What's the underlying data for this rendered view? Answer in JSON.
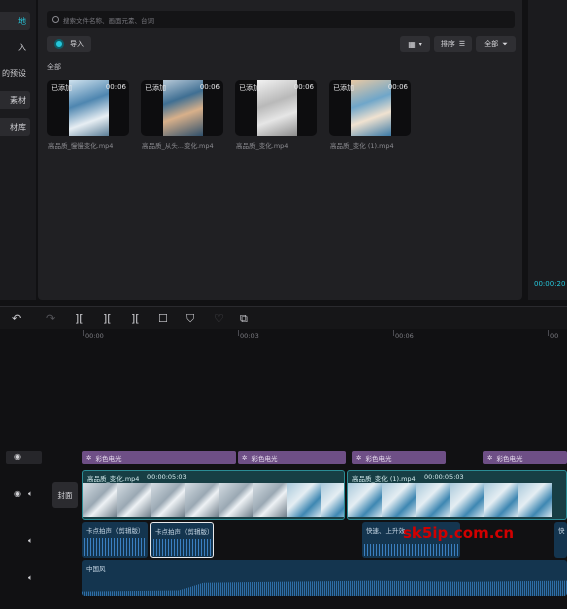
{
  "sidebar": {
    "items": [
      {
        "label": "地",
        "active": true
      },
      {
        "label": "入"
      },
      {
        "label": "的预设"
      },
      {
        "label": "素材"
      },
      {
        "label": "材库"
      }
    ]
  },
  "media": {
    "search_placeholder": "搜索文件名称、画面元素、台词",
    "import_label": "导入",
    "sort_label": "排序",
    "filter_label": "全部",
    "section_title": "全部",
    "items": [
      {
        "badge": "已添加",
        "duration": "00:06",
        "filename": "高品质_慢慢变化.mp4"
      },
      {
        "badge": "已添加",
        "duration": "00:06",
        "filename": "高品质_从头...变化.mp4"
      },
      {
        "badge": "已添加",
        "duration": "00:06",
        "filename": "高品质_变化.mp4"
      },
      {
        "badge": "已添加",
        "duration": "00:06",
        "filename": "高品质_变化 (1).mp4"
      }
    ]
  },
  "player": {
    "timecode": "00:00:20"
  },
  "ruler": {
    "labels": [
      "00:00",
      "00:03",
      "00:06",
      "00"
    ]
  },
  "timeline": {
    "cover_label": "封面",
    "effects": [
      "彩色电光",
      "彩色电光",
      "彩色电光",
      "彩色电光"
    ],
    "video_clips": [
      {
        "name": "高品质_变化.mp4",
        "duration": "00:00:05:03"
      },
      {
        "name": "高品质_变化 (1).mp4",
        "duration": "00:00:05:03"
      }
    ],
    "audio_clips": [
      {
        "label": "卡点拍声（剪辑版）"
      },
      {
        "label": "卡点拍声（剪辑版）"
      },
      {
        "label": "快速、上升效"
      },
      {
        "label": "快"
      }
    ],
    "music": {
      "label": "中国风"
    }
  },
  "watermark": "sk5ip.com.cn",
  "colors": {
    "accent": "#26c6da",
    "effect": "#6e4f86",
    "video": "#173e44",
    "audio": "#14354f",
    "watermark": "#d10000"
  }
}
